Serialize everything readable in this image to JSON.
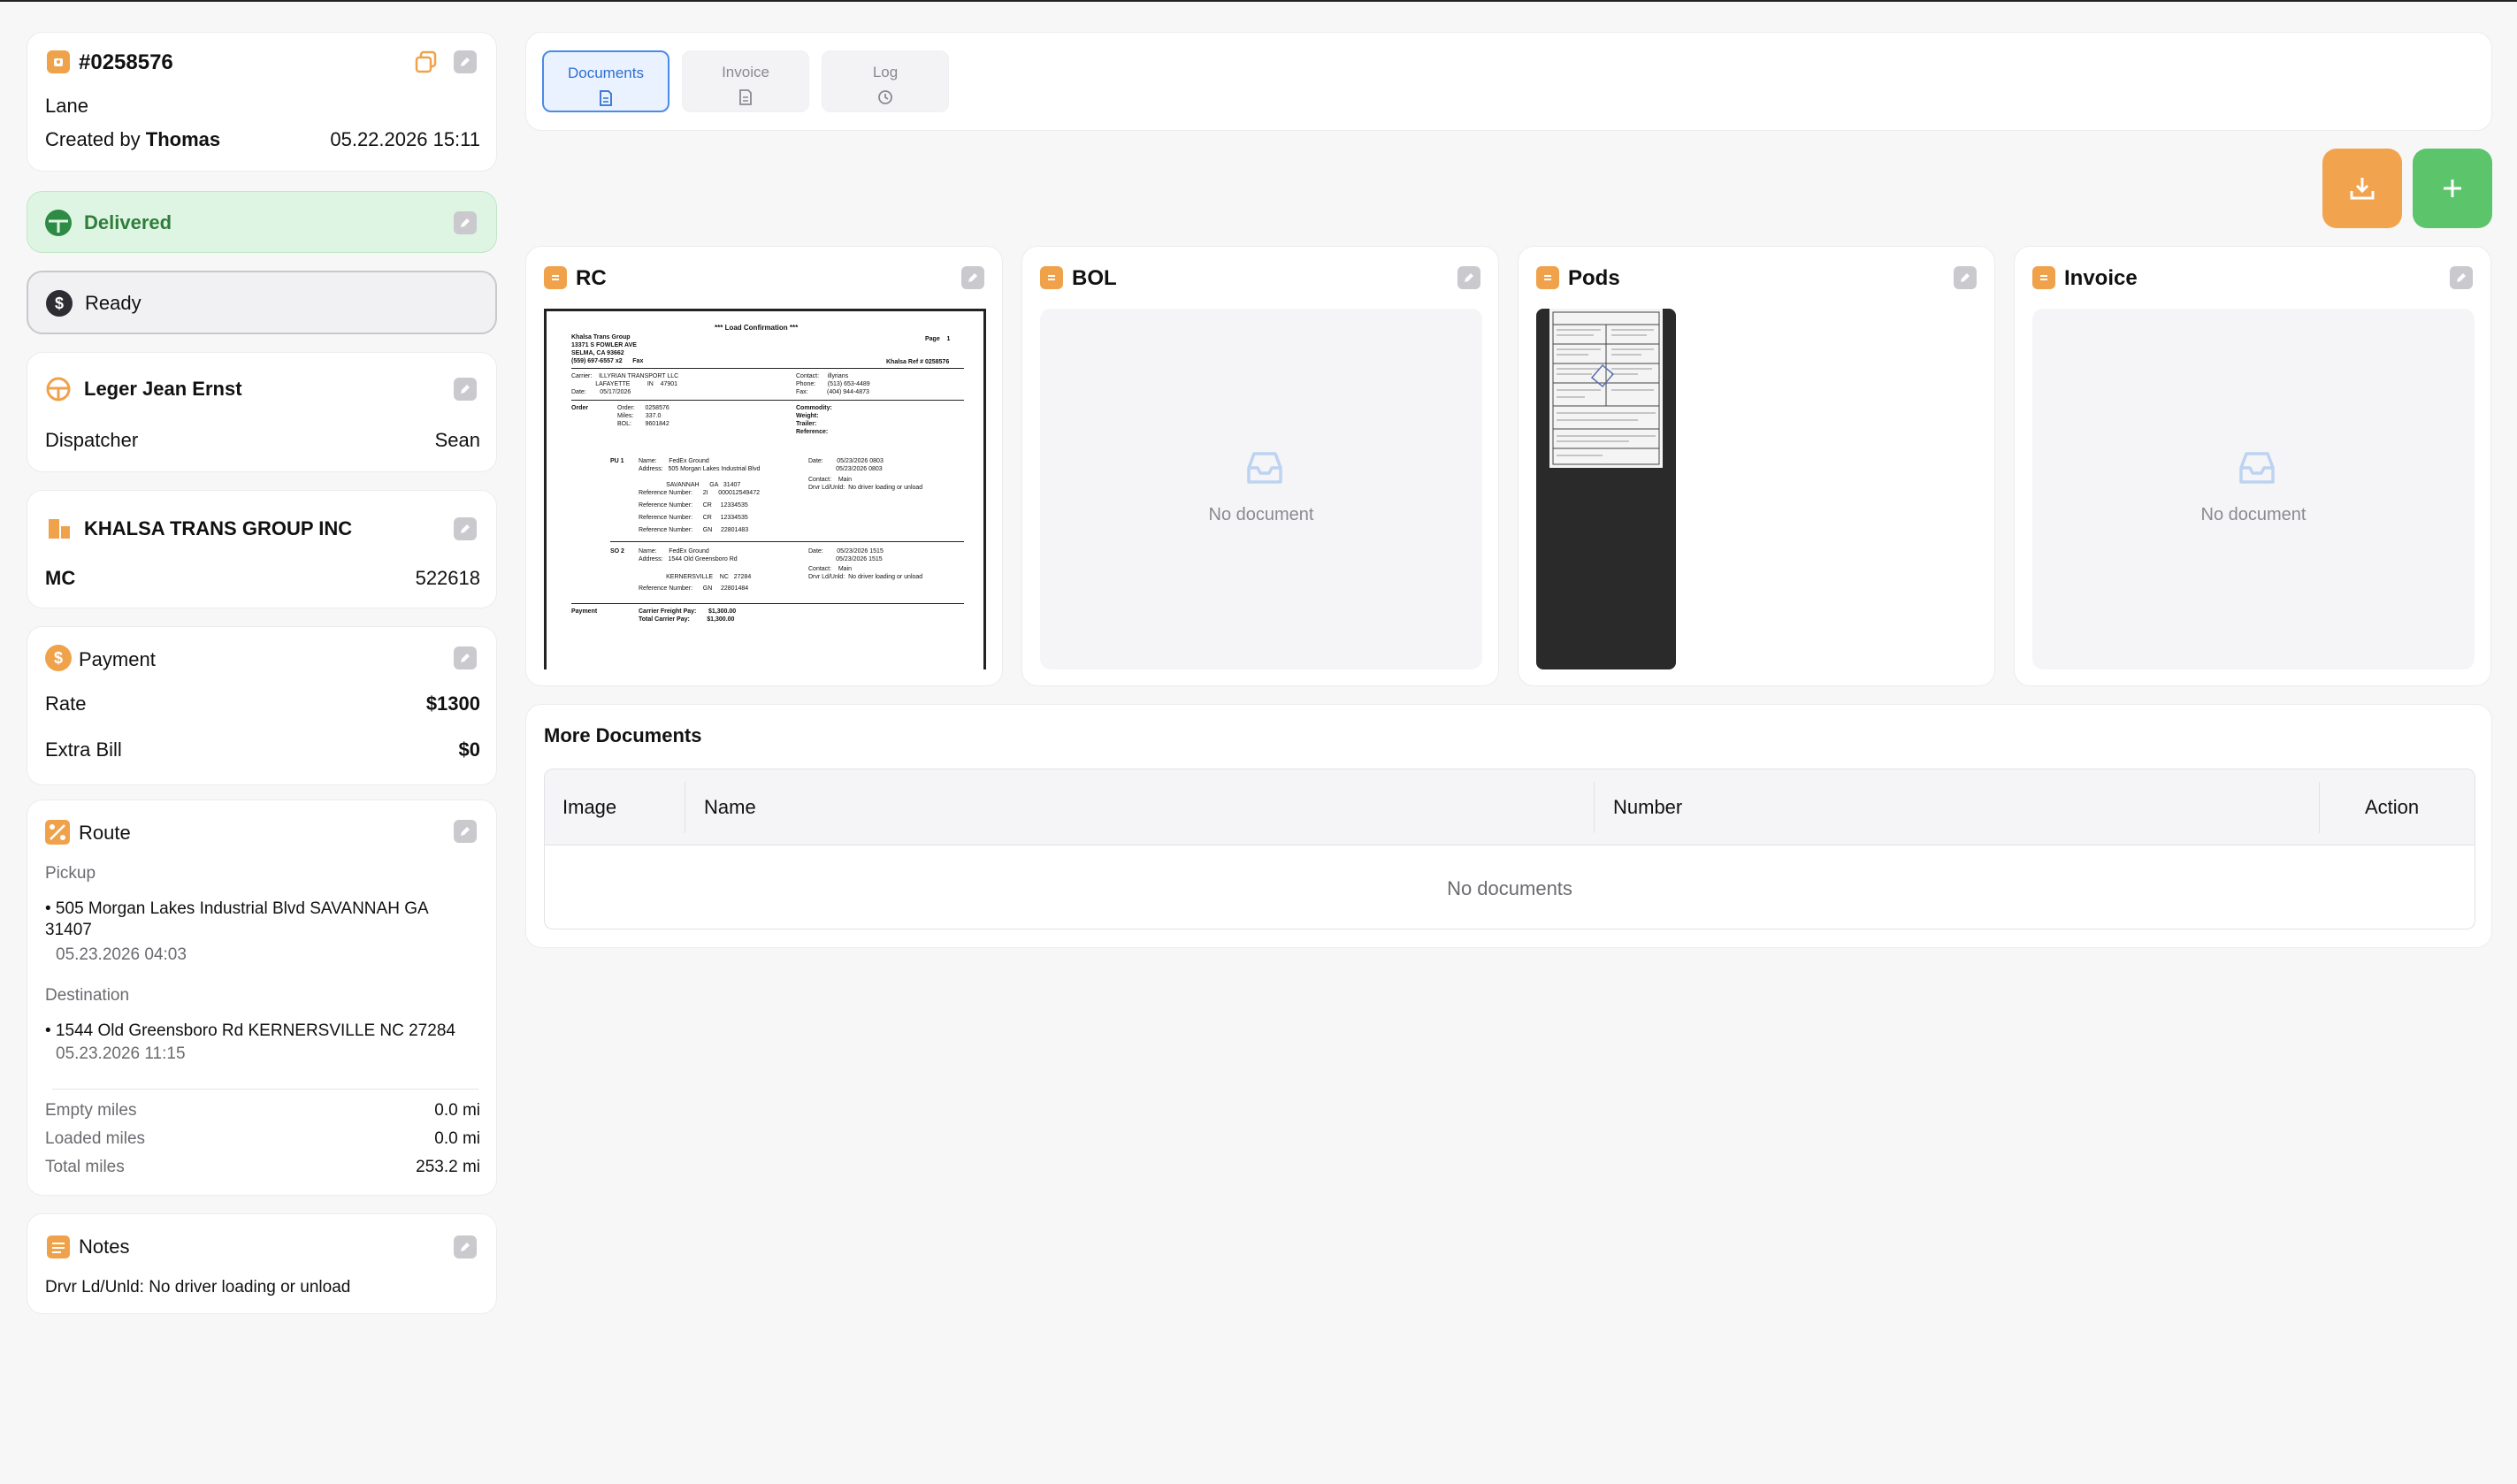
{
  "header": {
    "order_number": "#0258576",
    "lane_label": "Lane",
    "created_by_prefix": "Created by",
    "created_by_name": "Thomas",
    "created_at": "05.22.2026 15:11"
  },
  "statuses": {
    "delivery": "Delivered",
    "payment": "Ready",
    "delivery_color": "#dff5e3",
    "delivery_text_color": "#2e7d3b"
  },
  "driver": {
    "name": "Leger Jean Ernst",
    "dispatcher_label": "Dispatcher",
    "dispatcher_value": "Sean"
  },
  "company": {
    "name": "KHALSA TRANS GROUP INC",
    "mc_label": "MC",
    "mc_value": "522618"
  },
  "payment": {
    "title": "Payment",
    "rate_label": "Rate",
    "rate_value": "$1300",
    "extra_label": "Extra Bill",
    "extra_value": "$0"
  },
  "route": {
    "title": "Route",
    "pickup_label": "Pickup",
    "pickup_address_line1": "• 505 Morgan Lakes Industrial Blvd SAVANNAH GA",
    "pickup_address_line2": "31407",
    "pickup_time": "05.23.2026 04:03",
    "destination_label": "Destination",
    "destination_address": "• 1544 Old Greensboro Rd KERNERSVILLE NC 27284",
    "destination_time": "05.23.2026 11:15",
    "empty_miles_label": "Empty miles",
    "empty_miles_value": "0.0 mi",
    "loaded_miles_label": "Loaded miles",
    "loaded_miles_value": "0.0 mi",
    "total_miles_label": "Total miles",
    "total_miles_value": "253.2 mi"
  },
  "notes": {
    "title": "Notes",
    "text": "Drvr Ld/Unld: No driver loading or unload"
  },
  "tabs": [
    {
      "label": "Documents",
      "icon": "document-icon",
      "active": true
    },
    {
      "label": "Invoice",
      "icon": "document-icon",
      "active": false
    },
    {
      "label": "Log",
      "icon": "history-icon",
      "active": false
    }
  ],
  "actions": {
    "download_color": "#f2a34e",
    "add_color": "#5cc46a"
  },
  "documents": [
    {
      "title": "RC"
    },
    {
      "title": "BOL",
      "empty_text": "No document"
    },
    {
      "title": "Pods"
    },
    {
      "title": "Invoice",
      "empty_text": "No document"
    }
  ],
  "rc_preview": {
    "heading": "*** Load Confirmation ***",
    "company_lines": [
      "Khalsa Trans Group",
      "13371 S FOWLER AVE",
      "SELMA, CA 93662",
      "(559) 697-6557 x2      Fax"
    ],
    "page_label": "Page    1",
    "ref_label": "Khalsa Ref # 0258576",
    "carrier_lines": [
      "Carrier:    ILLYRIAN TRANSPORT LLC",
      "              LAFAYETTE          IN    47901",
      "Date:        05/17/2026"
    ],
    "contact_lines": [
      "Contact:     illyrians",
      "Phone:       (513) 653-4489",
      "Fax:           (404) 944-4873"
    ],
    "order_lines": [
      "Order:      0258576",
      "Miles:       337.0",
      "BOL:        9601842"
    ],
    "commodity_lines": [
      "Commodity:",
      "Weight:",
      "Trailer:",
      "Reference:"
    ],
    "pu_lines": [
      "Name:       FedEx Ground",
      "Address:   505 Morgan Lakes Industrial Blvd",
      "",
      "                SAVANNAH      GA   31407",
      "Reference Number:      2I      000012549472",
      "Reference Number:      CR     12334535",
      "Reference Number:      CR     12334535",
      "Reference Number:      GN     22801483"
    ],
    "pu_right": [
      "Date:        05/23/2026 0803",
      "                05/23/2026 0803",
      "Contact:    Main",
      "Drvr Ld/Unld:  No driver loading or unload"
    ],
    "so_lines": [
      "Name:       FedEx Ground",
      "Address:   1544 Old Greensboro Rd",
      "",
      "                KERNERSVILLE    NC   27284",
      "Reference Number:      GN     22801484"
    ],
    "so_right": [
      "Date:        05/23/2026 1515",
      "                05/23/2026 1515",
      "Contact:    Main",
      "Drvr Ld/Unld:  No driver loading or unload"
    ],
    "order_label": "Order",
    "pu_label": "PU 1",
    "so_label": "SO 2",
    "payment_label": "Payment",
    "payment_lines": [
      "Carrier Freight Pay:       $1,300.00",
      "Total Carrier Pay:          $1,300.00"
    ]
  },
  "more_documents": {
    "title": "More Documents",
    "columns": [
      "Image",
      "Name",
      "Number",
      "Action"
    ],
    "empty_text": "No documents"
  }
}
